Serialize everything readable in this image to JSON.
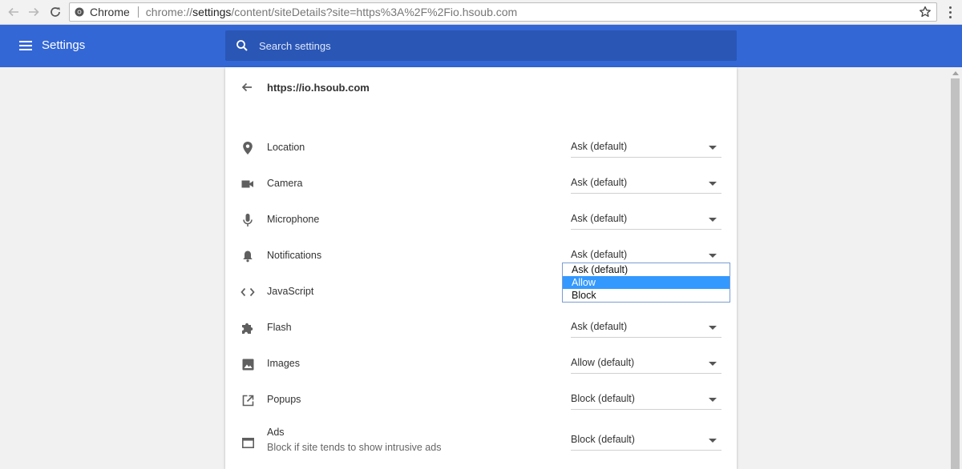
{
  "browser": {
    "tab_brand": "Chrome",
    "url_prefix": "chrome://",
    "url_host": "settings",
    "url_path": "/content/siteDetails?site=https%3A%2F%2Fio.hsoub.com"
  },
  "header": {
    "title": "Settings",
    "search_placeholder": "Search settings",
    "bar_color": "#3367d6"
  },
  "site": {
    "title": "https://io.hsoub.com"
  },
  "permissions": [
    {
      "label": "Location",
      "value": "Ask (default)",
      "icon": "location-pin-icon"
    },
    {
      "label": "Camera",
      "value": "Ask (default)",
      "icon": "camera-icon"
    },
    {
      "label": "Microphone",
      "value": "Ask (default)",
      "icon": "microphone-icon"
    },
    {
      "label": "Notifications",
      "value": "Ask (default)",
      "icon": "bell-icon"
    },
    {
      "label": "JavaScript",
      "value": "",
      "icon": "code-icon"
    },
    {
      "label": "Flash",
      "value": "Ask (default)",
      "icon": "puzzle-icon"
    },
    {
      "label": "Images",
      "value": "Allow (default)",
      "icon": "image-icon"
    },
    {
      "label": "Popups",
      "value": "Block (default)",
      "icon": "open-external-icon"
    },
    {
      "label": "Ads",
      "sublabel": "Block if site tends to show intrusive ads",
      "value": "Block (default)",
      "icon": "window-icon"
    }
  ],
  "dropdown": {
    "options": [
      "Ask (default)",
      "Allow",
      "Block"
    ],
    "highlighted": "Allow"
  }
}
